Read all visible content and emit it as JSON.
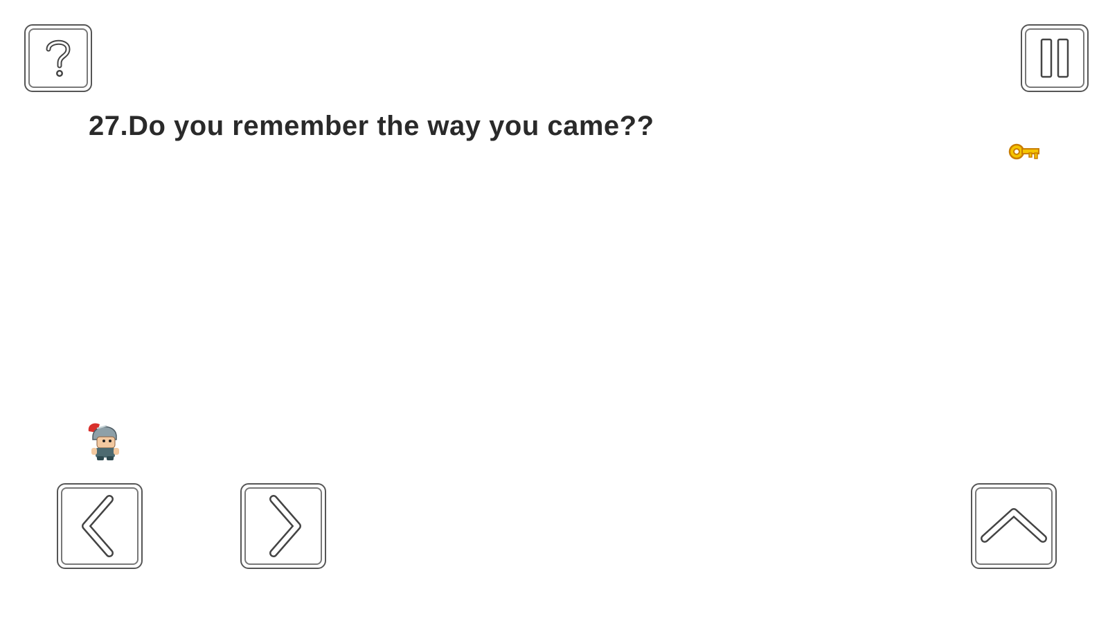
{
  "level": {
    "title": "27.Do you remember the way you came??"
  },
  "controls": {
    "help_icon": "question-mark-icon",
    "pause_icon": "pause-icon",
    "left_icon": "chevron-left-icon",
    "right_icon": "chevron-right-icon",
    "jump_icon": "chevron-up-icon"
  },
  "items": {
    "key_icon": "key-icon",
    "key_color": "#f0b400"
  },
  "player": {
    "sprite": "knight-character"
  },
  "colors": {
    "background": "#ffffff",
    "button_outline": "#555555",
    "text": "#2a2a2a"
  }
}
